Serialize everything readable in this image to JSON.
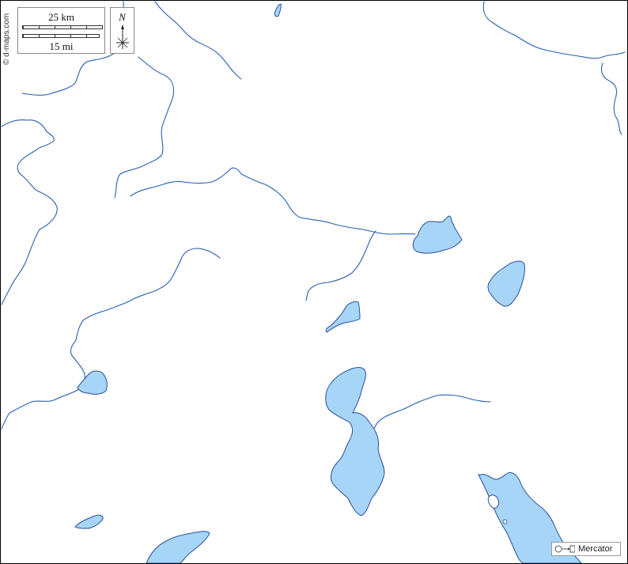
{
  "map": {
    "projection_label": "Mercator",
    "credit": "© d-maps.com",
    "colors": {
      "water_fill": "#a6d5f7",
      "water_outline": "#2a4f9a",
      "river": "#2a5fb0",
      "land": "#ffffff"
    }
  },
  "scale_bar": {
    "km_label": "25 km",
    "mi_label": "15 mi"
  },
  "north_arrow": {
    "letter": "N",
    "icon": "compass-rose-icon"
  }
}
